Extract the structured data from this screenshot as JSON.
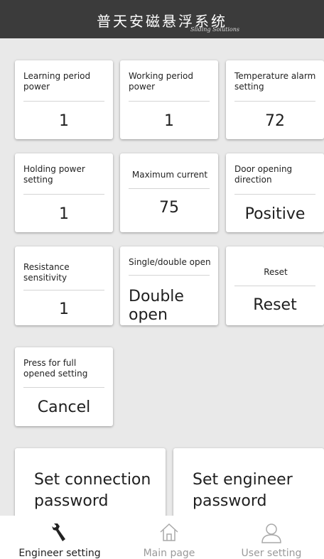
{
  "header": {
    "title": "普天安磁悬浮系统",
    "subtitle": "Sliding Solutions"
  },
  "cards": {
    "learning_period_power": {
      "label": "Learning period power",
      "value": "1"
    },
    "working_period_power": {
      "label": "Working period power",
      "value": "1"
    },
    "temperature_alarm_setting": {
      "label": "Temperature alarm setting",
      "value": "72"
    },
    "holding_power_setting": {
      "label": "Holding power setting",
      "value": "1"
    },
    "maximum_current": {
      "label": "Maximum current",
      "value": "75"
    },
    "door_opening_direction": {
      "label": "Door opening direction",
      "value": "Positive"
    },
    "resistance_sensitivity": {
      "label": "Resistance sensitivity",
      "value": "1"
    },
    "single_double_open": {
      "label": "Single/double open",
      "value": "Double open"
    },
    "reset": {
      "label": "Reset",
      "value": "Reset"
    },
    "full_opened_setting": {
      "label": "Press for full opened setting",
      "value": "Cancel"
    }
  },
  "buttons": {
    "set_connection_password": "Set connection password",
    "set_engineer_password": "Set engineer password"
  },
  "nav": {
    "engineer_setting": {
      "label": "Engineer setting",
      "icon": "wrench-icon",
      "active": true
    },
    "main_page": {
      "label": "Main page",
      "icon": "home-icon",
      "active": false
    },
    "user_setting": {
      "label": "User setting",
      "icon": "user-icon",
      "active": false
    }
  },
  "colors": {
    "header_bg": "#3b3b3b",
    "page_bg": "#e9e9e9",
    "nav_active": "#222222",
    "nav_inactive": "#9a9a9a"
  }
}
